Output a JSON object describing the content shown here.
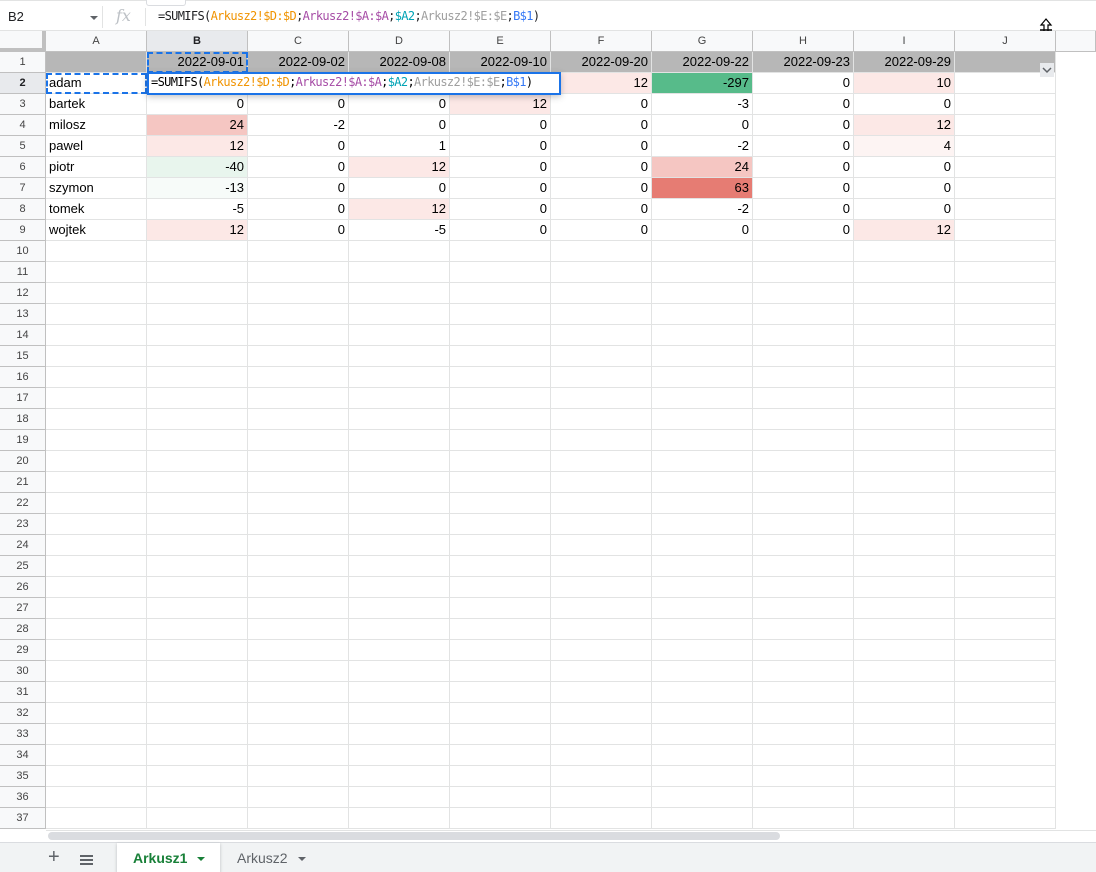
{
  "formula_bar": {
    "name_box": "B2",
    "fx_label": "fx",
    "formula_parts": [
      {
        "text": "=SUMIFS(",
        "cls": ""
      },
      {
        "text": "Arkusz2!$D:$D",
        "cls": "r1"
      },
      {
        "text": ";",
        "cls": ""
      },
      {
        "text": "Arkusz2!$A:$A",
        "cls": "r2"
      },
      {
        "text": ";",
        "cls": ""
      },
      {
        "text": "$A2",
        "cls": "r3"
      },
      {
        "text": ";",
        "cls": ""
      },
      {
        "text": "Arkusz2!$E:$E",
        "cls": "r4"
      },
      {
        "text": ";",
        "cls": ""
      },
      {
        "text": "B$1",
        "cls": "r5"
      },
      {
        "text": ")",
        "cls": ""
      }
    ]
  },
  "columns": [
    "A",
    "B",
    "C",
    "D",
    "E",
    "F",
    "G",
    "H",
    "I",
    "J"
  ],
  "selected_column": "B",
  "selected_row": 2,
  "row_count": 37,
  "header_row": [
    "",
    "2022-09-01",
    "2022-09-02",
    "2022-09-08",
    "2022-09-10",
    "2022-09-20",
    "2022-09-22",
    "2022-09-23",
    "2022-09-29",
    ""
  ],
  "header_fill": "#b7b7b7",
  "data_rows": [
    {
      "name": "adam",
      "values": [
        "",
        "",
        "",
        "",
        "12",
        "-297",
        "0",
        "10"
      ],
      "colors": [
        "",
        "",
        "",
        "",
        "#fce8e6",
        "#57bb8a",
        "",
        "#fce8e6"
      ]
    },
    {
      "name": "bartek",
      "values": [
        "0",
        "0",
        "0",
        "12",
        "0",
        "-3",
        "0",
        "0"
      ],
      "colors": [
        "",
        "",
        "",
        "#fce8e6",
        "",
        "",
        "",
        ""
      ]
    },
    {
      "name": "milosz",
      "values": [
        "24",
        "-2",
        "0",
        "0",
        "0",
        "0",
        "0",
        "12"
      ],
      "colors": [
        "#f5c6c2",
        "",
        "",
        "",
        "",
        "",
        "",
        "#fce8e6"
      ]
    },
    {
      "name": "pawel",
      "values": [
        "12",
        "0",
        "1",
        "0",
        "0",
        "-2",
        "0",
        "4"
      ],
      "colors": [
        "#fce8e6",
        "",
        "",
        "",
        "",
        "",
        "",
        "#fdf4f3"
      ]
    },
    {
      "name": "piotr",
      "values": [
        "-40",
        "0",
        "12",
        "0",
        "0",
        "24",
        "0",
        "0"
      ],
      "colors": [
        "#e8f5ed",
        "",
        "#fce8e6",
        "",
        "",
        "#f5c6c2",
        "",
        ""
      ]
    },
    {
      "name": "szymon",
      "values": [
        "-13",
        "0",
        "0",
        "0",
        "0",
        "63",
        "0",
        "0"
      ],
      "colors": [
        "#f7fbf9",
        "",
        "",
        "",
        "",
        "#e67c73",
        "",
        ""
      ]
    },
    {
      "name": "tomek",
      "values": [
        "-5",
        "0",
        "12",
        "0",
        "0",
        "-2",
        "0",
        "0"
      ],
      "colors": [
        "",
        "",
        "#fce8e6",
        "",
        "",
        "",
        "",
        ""
      ]
    },
    {
      "name": "wojtek",
      "values": [
        "12",
        "0",
        "-5",
        "0",
        "0",
        "0",
        "0",
        "12"
      ],
      "colors": [
        "#fce8e6",
        "",
        "",
        "",
        "",
        "",
        "",
        "#fce8e6"
      ]
    }
  ],
  "editor": {
    "parts": [
      {
        "text": "=SUMIFS(",
        "cls": ""
      },
      {
        "text": "Arkusz2!$D:$D",
        "cls": "r1"
      },
      {
        "text": ";",
        "cls": ""
      },
      {
        "text": "Arkusz2!$A:$A",
        "cls": "r2"
      },
      {
        "text": ";",
        "cls": ""
      },
      {
        "text": "$A2",
        "cls": "r3"
      },
      {
        "text": ";",
        "cls": ""
      },
      {
        "text": "Arkusz2!$E:$E",
        "cls": "r4"
      },
      {
        "text": ";",
        "cls": ""
      },
      {
        "text": "B$1",
        "cls": "r5"
      },
      {
        "text": ")",
        "cls": ""
      }
    ]
  },
  "sheet_tabs": [
    {
      "label": "Arkusz1",
      "active": true
    },
    {
      "label": "Arkusz2",
      "active": false
    }
  ],
  "accent_color": "#1a73e8",
  "active_tab_color": "#188038"
}
